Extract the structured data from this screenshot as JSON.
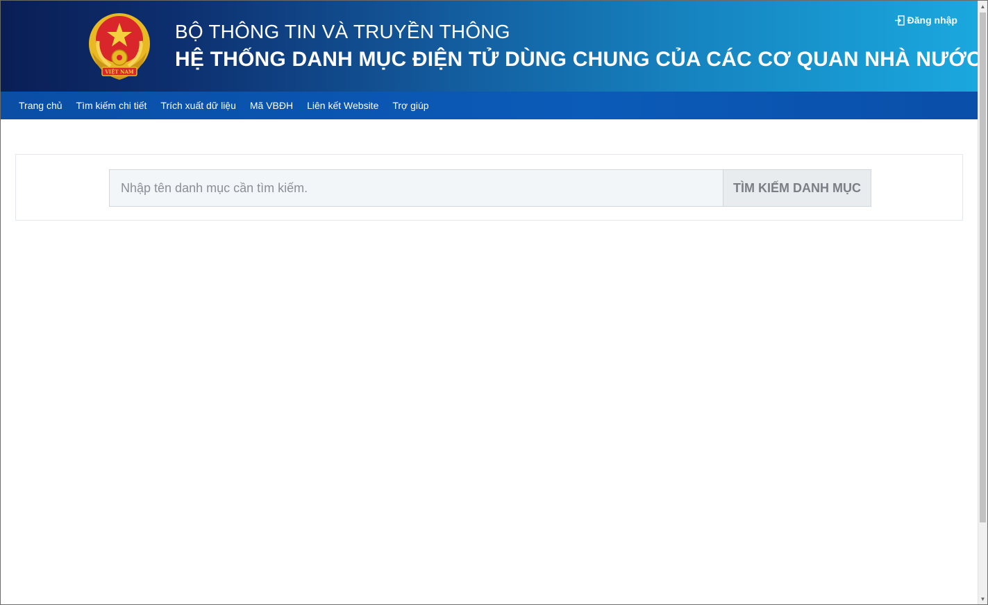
{
  "header": {
    "ministry": "BỘ THÔNG TIN VÀ TRUYỀN THÔNG",
    "system_title": "HỆ THỐNG DANH MỤC ĐIỆN TỬ DÙNG CHUNG CỦA CÁC CƠ QUAN NHÀ NƯỚC",
    "login_label": "Đăng nhập",
    "emblem_text": "VIỆT NAM"
  },
  "nav": {
    "items": [
      {
        "label": "Trang chủ"
      },
      {
        "label": "Tìm kiếm chi tiết"
      },
      {
        "label": "Trích xuất dữ liệu"
      },
      {
        "label": "Mã VBĐH"
      },
      {
        "label": "Liên kết Website"
      },
      {
        "label": "Trợ giúp"
      }
    ]
  },
  "search": {
    "placeholder": "Nhập tên danh mục cần tìm kiếm.",
    "value": "",
    "button_label": "TÌM KIẾM DANH MỤC"
  },
  "colors": {
    "header_start": "#0a1e55",
    "header_end": "#1aa8de",
    "nav_bg": "#0b5bb8",
    "emblem_red": "#d8262b",
    "emblem_gold": "#f0c419"
  },
  "icons": {
    "emblem": "national-emblem-icon",
    "login": "sign-in-icon"
  }
}
